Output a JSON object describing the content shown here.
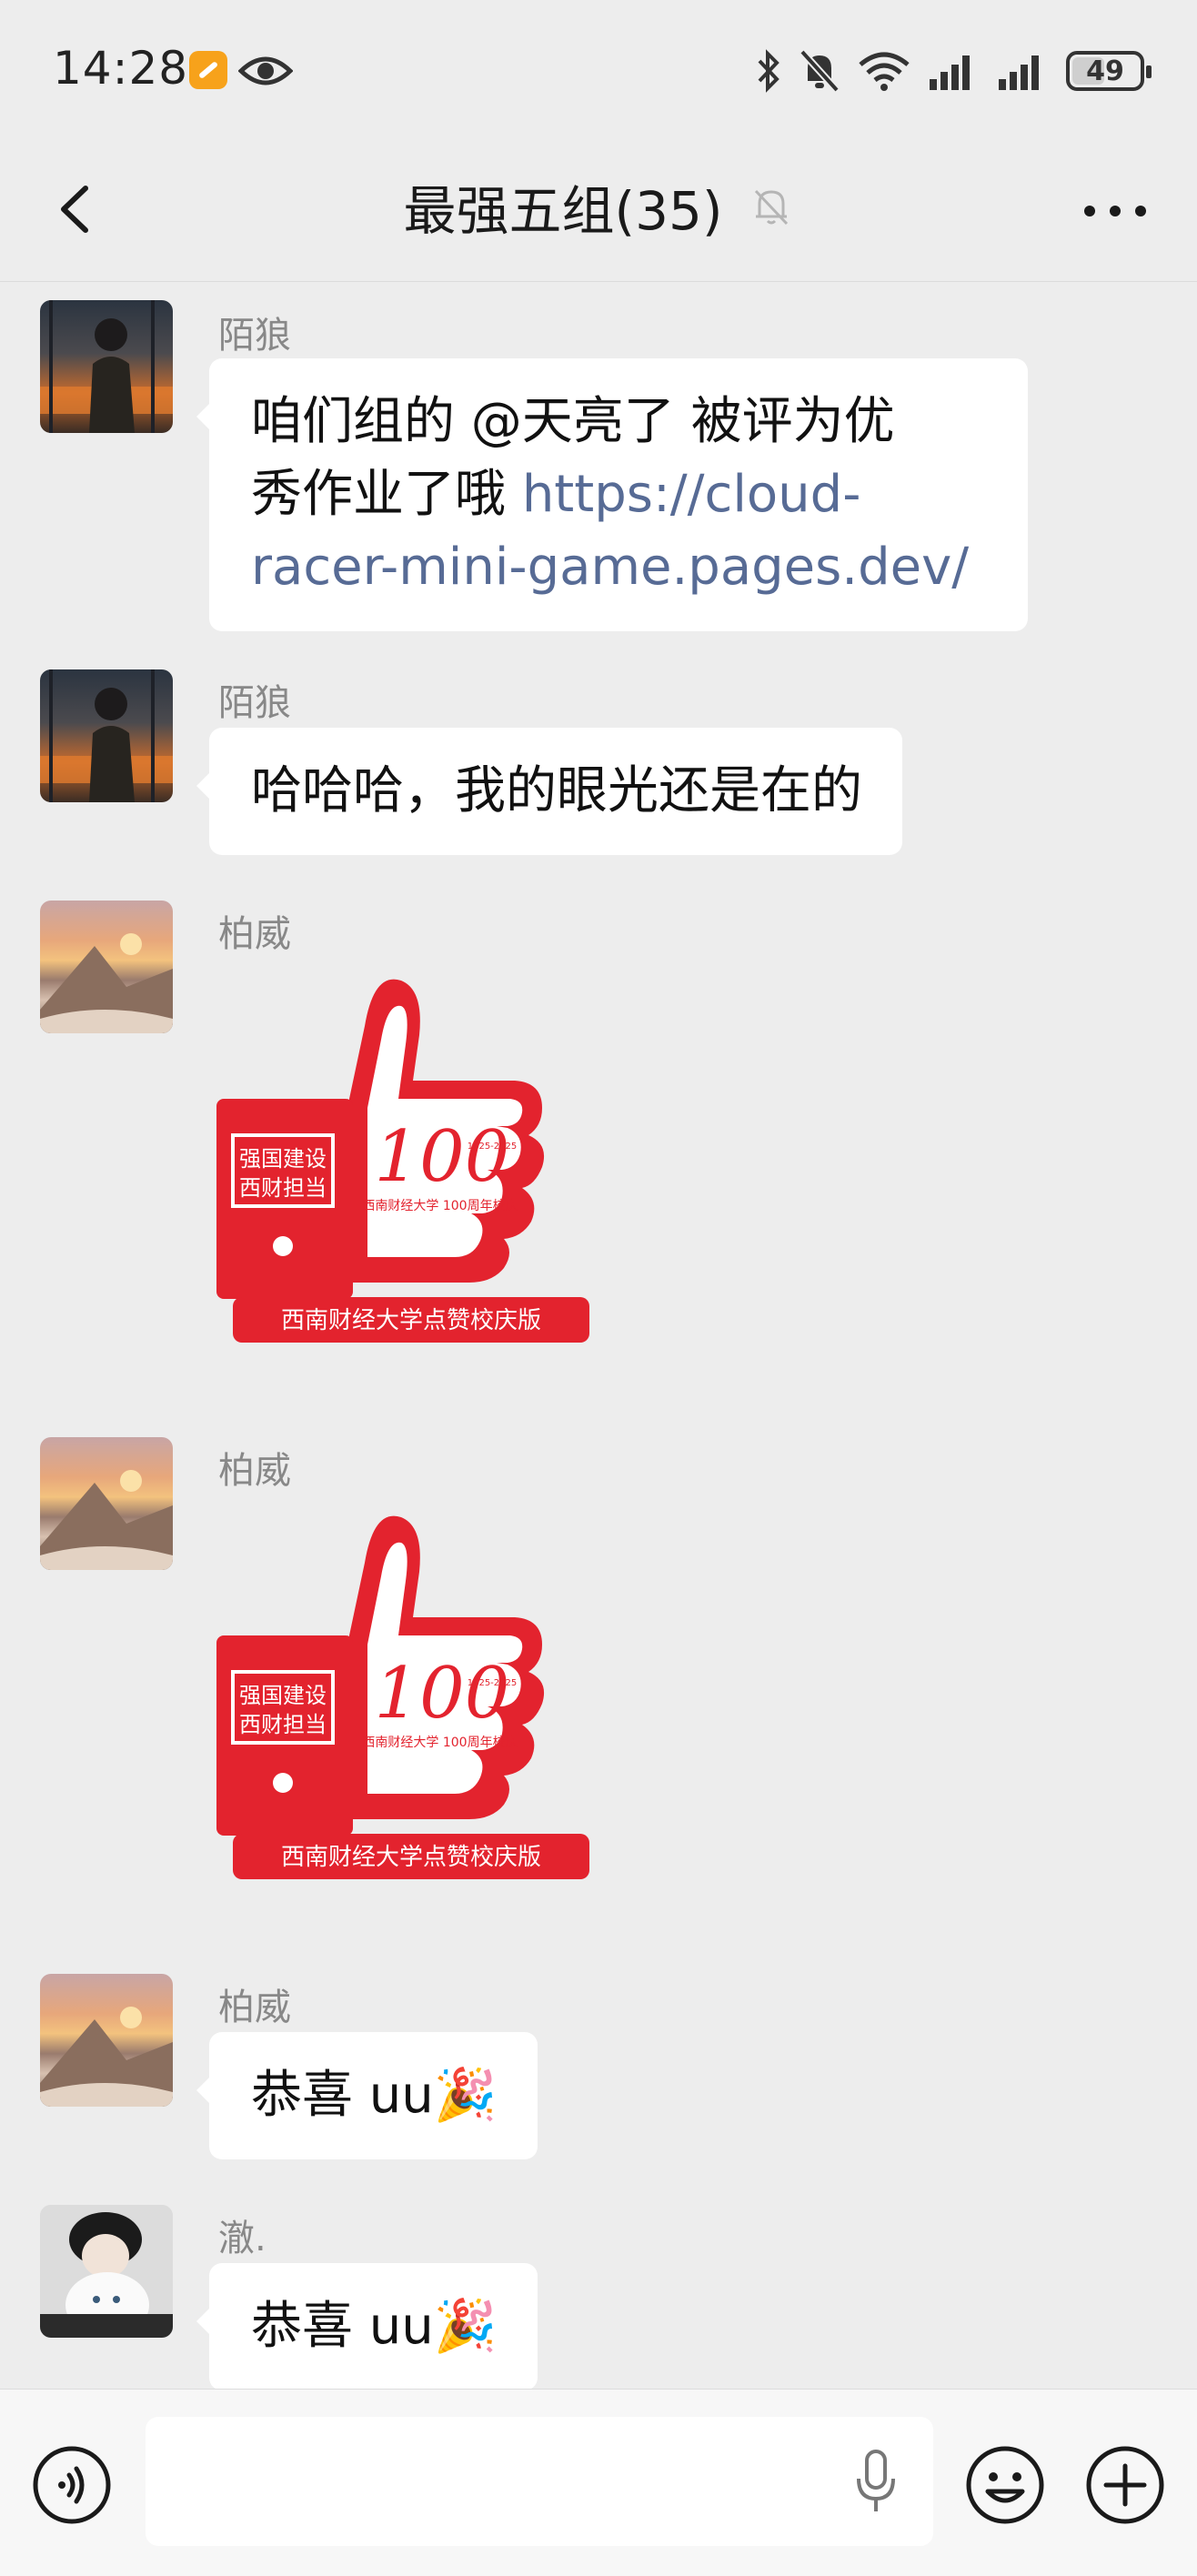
{
  "status_bar": {
    "time": "14:28",
    "battery": "49",
    "battery_level": 0.49
  },
  "header": {
    "title": "最强五组(35)",
    "back_icon": "chevron-left-icon",
    "mute_icon": "bell-off-icon",
    "more_icon": "more-horizontal-icon"
  },
  "messages": [
    {
      "sender": "陌狼",
      "text_lines": [
        "咱们组的 @天亮了  被评为优",
        "秀作业了哦 "
      ],
      "link_part1": "https://cloud-",
      "link_part2": "racer-mini-game.pages.dev/"
    },
    {
      "sender": "陌狼",
      "text": "哈哈哈，我的眼光还是在的"
    },
    {
      "sender": "柏威",
      "sticker": {
        "badge_line1": "强国建设",
        "badge_line2": "西财担当",
        "number": "100",
        "year_text": "1925-2025",
        "school": "西南财经大学 100周年校庆",
        "caption": "西南财经大学点赞校庆版"
      }
    },
    {
      "sender": "柏威",
      "sticker": {
        "badge_line1": "强国建设",
        "badge_line2": "西财担当",
        "number": "100",
        "year_text": "1925-2025",
        "school": "西南财经大学 100周年校庆",
        "caption": "西南财经大学点赞校庆版"
      }
    },
    {
      "sender": "柏威",
      "text": "恭喜 uu🎉"
    },
    {
      "sender": "澈.",
      "text": "恭喜 uu🎉"
    }
  ],
  "input_bar": {
    "voice_icon": "voice-mode-icon",
    "mic_icon": "microphone-icon",
    "emoji_icon": "emoji-icon",
    "plus_icon": "plus-circle-icon"
  }
}
